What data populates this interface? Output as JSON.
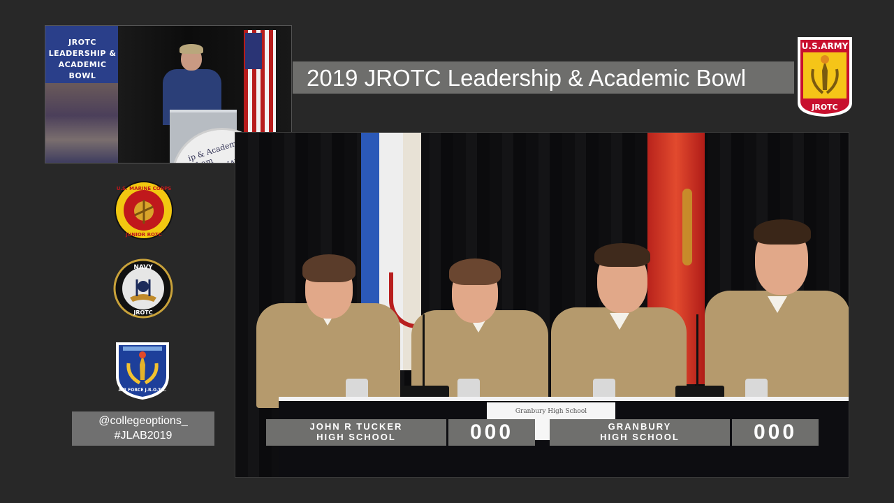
{
  "broadcast": {
    "title": "2019 JROTC Leadership & Academic Bowl"
  },
  "inset": {
    "banner_text": "JROTC\nLEADERSHIP &\nACADEMIC BOWL",
    "podium_text": "ip & Academic Cham\nFORCE NAVY MA"
  },
  "army_badge": {
    "top_text": "U.S.ARMY",
    "bottom_text": "JROTC",
    "color_red": "#c8102e",
    "color_gold": "#f5c518"
  },
  "emblems": {
    "marine": {
      "text": "U.S. MARINE CORPS",
      "sub": "JUNIOR ROTC"
    },
    "navy": {
      "text": "NAVY",
      "sub": "JROTC"
    },
    "airforce": {
      "text": "AIR FORCE J.R.O.T.C."
    }
  },
  "social": {
    "handle": "@collegeoptions_",
    "hashtag": "#JLAB2019"
  },
  "scoreboard": {
    "team1": {
      "line1": "JOHN R TUCKER",
      "line2": "HIGH SCHOOL",
      "score": "000"
    },
    "team2": {
      "line1": "GRANBURY",
      "line2": "HIGH SCHOOL",
      "score": "000"
    }
  },
  "stage": {
    "placard_text": "Granbury High School"
  }
}
